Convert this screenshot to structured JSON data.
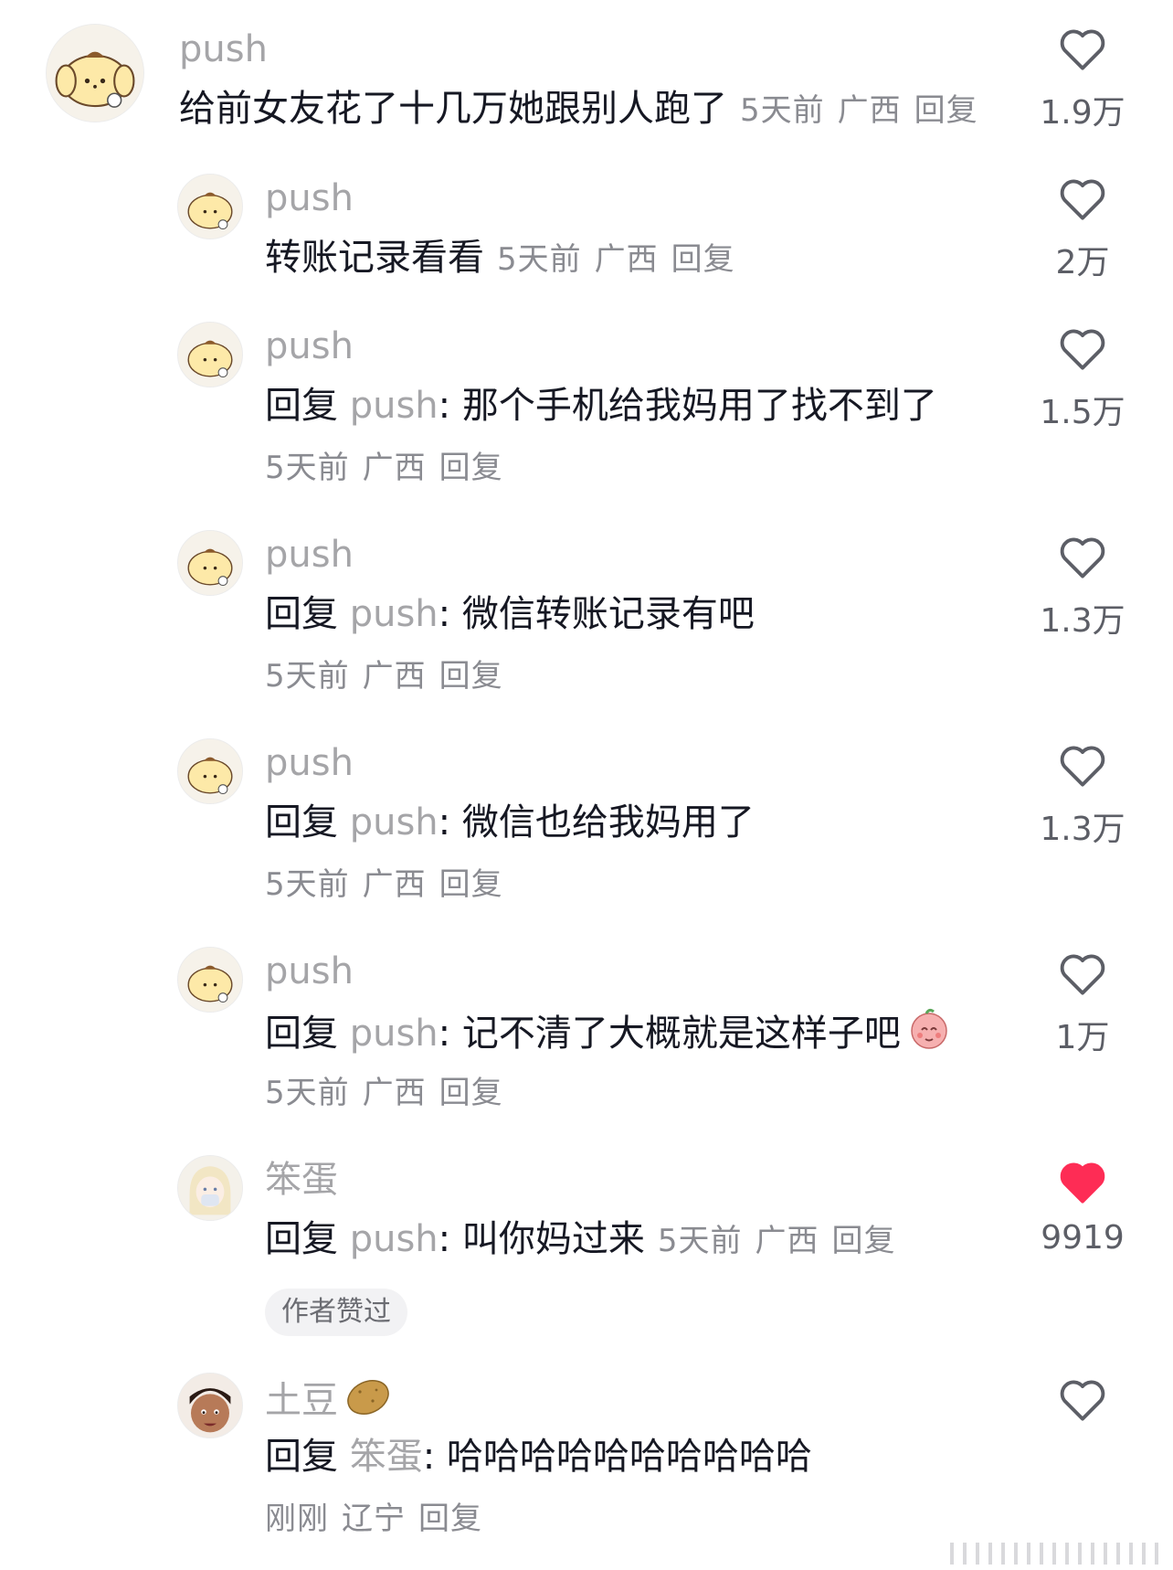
{
  "comments": [
    {
      "username": "push",
      "text": "给前女友花了十几万她跟别人跑了",
      "time": "5天前",
      "location": "广西",
      "reply_label": "回复",
      "likes": "1.9万",
      "liked": false
    },
    {
      "username": "push",
      "text": "转账记录看看",
      "time": "5天前",
      "location": "广西",
      "reply_label": "回复",
      "likes": "2万",
      "liked": false
    },
    {
      "username": "push",
      "reply_prefix": "回复",
      "reply_target": "push",
      "text": "那个手机给我妈用了找不到了",
      "time": "5天前",
      "location": "广西",
      "reply_label": "回复",
      "likes": "1.5万",
      "liked": false
    },
    {
      "username": "push",
      "reply_prefix": "回复",
      "reply_target": "push",
      "text": "微信转账记录有吧",
      "time": "5天前",
      "location": "广西",
      "reply_label": "回复",
      "likes": "1.3万",
      "liked": false
    },
    {
      "username": "push",
      "reply_prefix": "回复",
      "reply_target": "push",
      "text": "微信也给我妈用了",
      "time": "5天前",
      "location": "广西",
      "reply_label": "回复",
      "likes": "1.3万",
      "liked": false
    },
    {
      "username": "push",
      "reply_prefix": "回复",
      "reply_target": "push",
      "text": "记不清了大概就是这样子吧",
      "time": "5天前",
      "location": "广西",
      "reply_label": "回复",
      "likes": "1万",
      "liked": false
    },
    {
      "username": "笨蛋",
      "reply_prefix": "回复",
      "reply_target": "push",
      "text": "叫你妈过来",
      "time": "5天前",
      "location": "广西",
      "reply_label": "回复",
      "likes": "9919",
      "liked": true,
      "badge": "作者赞过"
    },
    {
      "username": "土豆",
      "reply_prefix": "回复",
      "reply_target": "笨蛋",
      "text": "哈哈哈哈哈哈哈哈哈哈",
      "time": "刚刚",
      "location": "辽宁",
      "reply_label": "回复",
      "likes": "",
      "liked": false
    }
  ],
  "colors": {
    "text": "#161823",
    "muted": "#a5a5a8",
    "meta": "#8a8b91",
    "liked_heart": "#fe2c55"
  },
  "icons": {
    "like": "heart-outline-icon",
    "liked": "heart-filled-icon",
    "potato": "potato-emoji",
    "emoji": "blushing-face-emoji"
  },
  "punctuation": {
    "colon": ":"
  }
}
